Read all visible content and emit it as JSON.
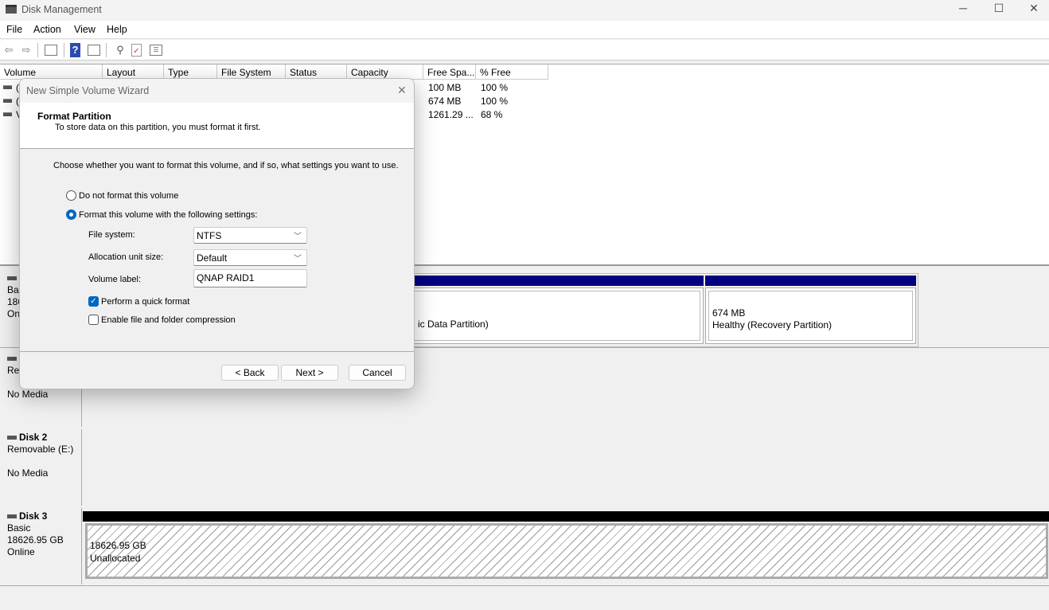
{
  "window": {
    "title": "Disk Management",
    "minimize": "─",
    "maximize": "☐",
    "close": "✕"
  },
  "menu": [
    "File",
    "Action",
    "View",
    "Help"
  ],
  "toolbar": {
    "back": "⇦",
    "forward": "⇨",
    "help": "?"
  },
  "volume_list": {
    "columns": [
      "Volume",
      "Layout",
      "Type",
      "File System",
      "Status",
      "Capacity",
      "Free Spa...",
      "% Free"
    ],
    "rows": [
      {
        "volume": "(",
        "free": "100 MB",
        "pct": "100 %"
      },
      {
        "volume": "(",
        "free": "674 MB",
        "pct": "100 %"
      },
      {
        "volume": "V",
        "free": "1261.29 ...",
        "pct": "68 %"
      }
    ]
  },
  "disks": [
    {
      "name_fragment": "",
      "lines": [
        "Bas",
        "186",
        "On"
      ],
      "partitions": [
        {
          "label": "ic Data Partition)"
        },
        {
          "size": "674 MB",
          "label": "Healthy (Recovery Partition)"
        }
      ]
    },
    {
      "lines": [
        "Re",
        "",
        "No Media"
      ]
    },
    {
      "name": "Disk 2",
      "lines": [
        "Removable (E:)",
        "",
        "No Media"
      ]
    },
    {
      "name": "Disk 3",
      "lines": [
        "Basic",
        "18626.95 GB",
        "Online"
      ],
      "partitions": [
        {
          "size": "18626.95 GB",
          "label": "Unallocated"
        }
      ]
    }
  ],
  "colors": {
    "primary_partition": "#000080",
    "unallocated": "#000000",
    "accent": "#0067c0"
  },
  "dialog": {
    "title": "New Simple Volume Wizard",
    "close": "✕",
    "heading": "Format Partition",
    "subheading": "To store data on this partition, you must format it first.",
    "instruction": "Choose whether you want to format this volume, and if so, what settings you want to use.",
    "option_no_format": "Do not format this volume",
    "option_format": "Format this volume with the following settings:",
    "file_system_label": "File system:",
    "file_system_value": "NTFS",
    "allocation_label": "Allocation unit size:",
    "allocation_value": "Default",
    "volume_label_label": "Volume label:",
    "volume_label_value": "QNAP RAID1",
    "quick_format": "Perform a quick format",
    "quick_format_checked": true,
    "compression": "Enable file and folder compression",
    "compression_checked": false,
    "back": "< Back",
    "next": "Next >",
    "cancel": "Cancel"
  }
}
